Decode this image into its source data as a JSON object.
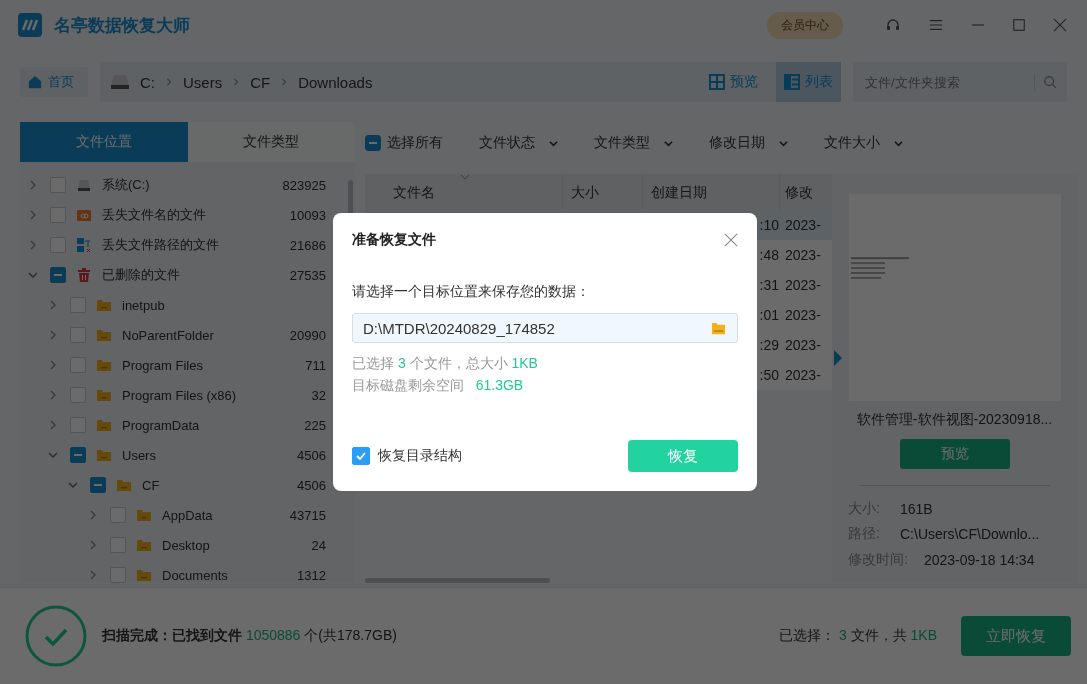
{
  "window": {
    "title": "名亭数据恢复大师",
    "member_button": "会员中心"
  },
  "toolbar": {
    "home": "首页",
    "breadcrumb": [
      "C:",
      "Users",
      "CF",
      "Downloads"
    ],
    "views": [
      {
        "label": "预览",
        "kind": "grid",
        "selected": false
      },
      {
        "label": "列表",
        "kind": "list",
        "selected": true
      }
    ],
    "search": {
      "placeholder": "文件/文件夹搜索"
    }
  },
  "sidebar": {
    "tabs": [
      {
        "label": "文件位置",
        "selected": true
      },
      {
        "label": "文件类型",
        "selected": false
      }
    ],
    "tree": [
      {
        "label": "系统(C:)",
        "kind": "drive",
        "count": "823925",
        "expanded": false,
        "indeterminate": false
      },
      {
        "label": "丢失文件名的文件",
        "kind": "lostname",
        "count": "10093",
        "expanded": false,
        "indeterminate": false
      },
      {
        "label": "丢失文件路径的文件",
        "kind": "lostpath",
        "count": "21686",
        "expanded": false,
        "indeterminate": false
      },
      {
        "label": "已删除的文件",
        "kind": "trash",
        "count": "27535",
        "expanded": true,
        "indeterminate": true,
        "children": [
          {
            "label": "inetpub",
            "kind": "folder",
            "expanded": false,
            "indeterminate": false
          },
          {
            "label": "NoParentFolder",
            "kind": "folder",
            "count": "20990",
            "expanded": false,
            "indeterminate": false
          },
          {
            "label": "Program Files",
            "kind": "folder",
            "count": "711",
            "expanded": false,
            "indeterminate": false
          },
          {
            "label": "Program Files (x86)",
            "kind": "folder",
            "count": "32",
            "expanded": false,
            "indeterminate": false
          },
          {
            "label": "ProgramData",
            "kind": "folder",
            "count": "225",
            "expanded": false,
            "indeterminate": false
          },
          {
            "label": "Users",
            "kind": "folder",
            "count": "4506",
            "expanded": true,
            "indeterminate": true,
            "children": [
              {
                "label": "CF",
                "kind": "folder",
                "count": "4506",
                "expanded": true,
                "indeterminate": true,
                "children": [
                  {
                    "label": "AppData",
                    "kind": "folder",
                    "count": "43715",
                    "expanded": false,
                    "indeterminate": false
                  },
                  {
                    "label": "Desktop",
                    "kind": "folder",
                    "count": "24",
                    "expanded": false,
                    "indeterminate": false
                  },
                  {
                    "label": "Documents",
                    "kind": "folder",
                    "count": "1312",
                    "expanded": false,
                    "indeterminate": false
                  }
                ]
              }
            ]
          }
        ]
      }
    ]
  },
  "filters": {
    "select_all": {
      "label": "选择所有",
      "indeterminate": true
    },
    "dropdowns": [
      "文件状态",
      "文件类型",
      "修改日期",
      "文件大小"
    ]
  },
  "table": {
    "columns": [
      "文件名",
      "大小",
      "创建日期",
      "修改"
    ],
    "rows": [
      {
        "selected": true,
        "created": ":10",
        "modified": "2023-"
      },
      {
        "selected": false,
        "created": ":48",
        "modified": "2023-"
      },
      {
        "selected": false,
        "created": ":31",
        "modified": "2023-"
      },
      {
        "selected": false,
        "created": ":01",
        "modified": "2023-"
      },
      {
        "selected": false,
        "created": ":29",
        "modified": "2023-"
      },
      {
        "selected": false,
        "created": ":50",
        "modified": "2023-"
      }
    ]
  },
  "preview": {
    "filename": "软件管理-软件视图-20230918...",
    "button": "预览",
    "info": [
      {
        "label": "大小:",
        "value": "161B"
      },
      {
        "label": "路径:",
        "value": "C:\\Users\\CF\\Downlo..."
      },
      {
        "label": "修改时间:",
        "value": "2023-09-18 14:34"
      }
    ]
  },
  "status_bar": {
    "done": "扫描完成：已找到文件",
    "found": "1050886",
    "found_suffix": "个(共178.7GB)",
    "selected_label": "已选择：",
    "selected_count": "3",
    "selected_mid": "文件，共",
    "selected_size": "1KB",
    "button": "立即恢复"
  },
  "dialog": {
    "title": "准备恢复文件",
    "prompt": "请选择一个目标位置来保存您的数据：",
    "path": "D:\\MTDR\\20240829_174852",
    "summary": {
      "prefix": "已选择",
      "count": "3",
      "mid": "个文件，总大小",
      "size": "1KB"
    },
    "space": {
      "label": "目标磁盘剩余空间",
      "value": "61.3GB"
    },
    "keep_structure": {
      "label": "恢复目录结构",
      "checked": true
    },
    "button": "恢复"
  }
}
